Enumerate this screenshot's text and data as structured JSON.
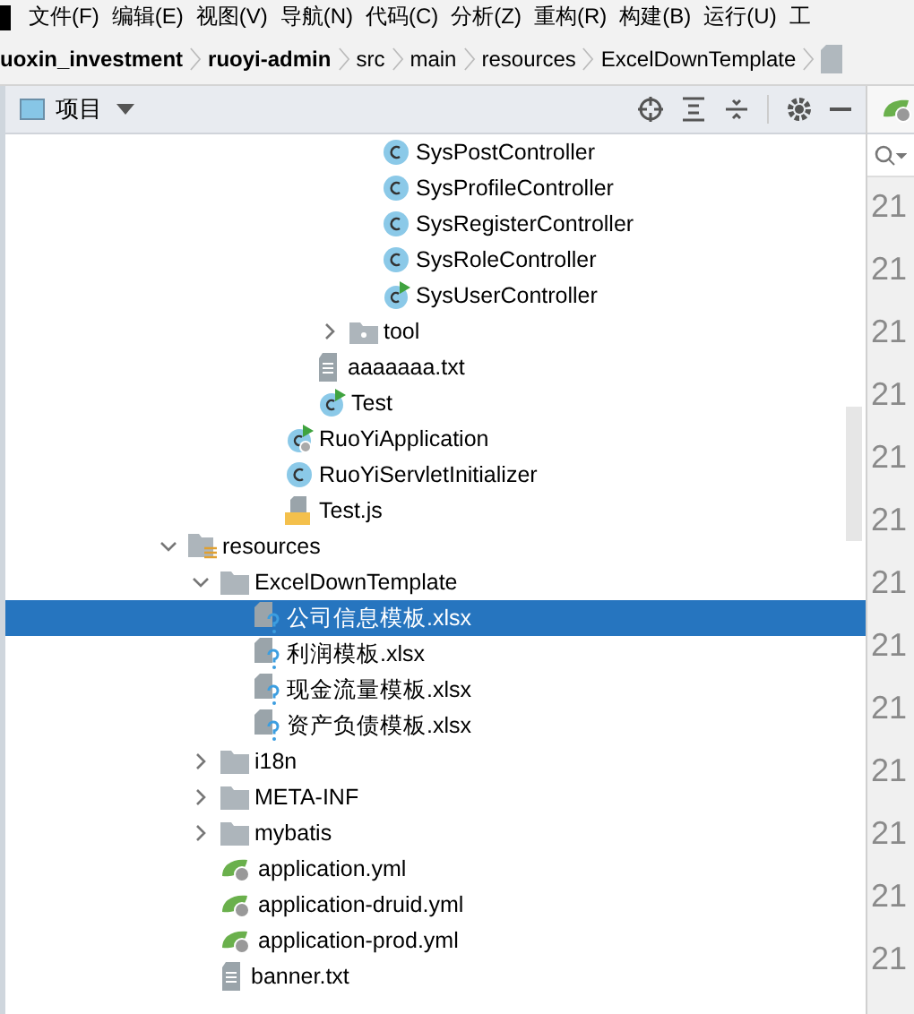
{
  "menu_bar": [
    "文件(F)",
    "编辑(E)",
    "视图(V)",
    "导航(N)",
    "代码(C)",
    "分析(Z)",
    "重构(R)",
    "构建(B)",
    "运行(U)",
    "工"
  ],
  "breadcrumb": [
    {
      "label": "uoxin_investment",
      "bold": true
    },
    {
      "label": "ruoyi-admin",
      "bold": true
    },
    {
      "label": "src",
      "bold": false
    },
    {
      "label": "main",
      "bold": false
    },
    {
      "label": "resources",
      "bold": false
    },
    {
      "label": "ExcelDownTemplate",
      "bold": false
    }
  ],
  "project_panel": {
    "title": "项目"
  },
  "tree": [
    {
      "kind": "group",
      "children": [
        {
          "kind": "group",
          "children": [
            {
              "kind": "group",
              "children": [
                {
                  "kind": "group",
                  "children": [
                    {
                      "kind": "group",
                      "children": [
                        {
                          "kind": "group",
                          "children": [
                            {
                              "kind": "class",
                              "label": "SysPostController",
                              "selected": false
                            },
                            {
                              "kind": "class",
                              "label": "SysProfileController",
                              "selected": false
                            },
                            {
                              "kind": "class",
                              "label": "SysRegisterController",
                              "selected": false
                            },
                            {
                              "kind": "class",
                              "label": "SysRoleController",
                              "selected": false
                            },
                            {
                              "kind": "runnable-class",
                              "label": "SysUserController",
                              "selected": false
                            }
                          ]
                        },
                        {
                          "kind": "package",
                          "label": "tool",
                          "expanded": false,
                          "selected": false
                        }
                      ]
                    },
                    {
                      "kind": "text-file",
                      "label": "aaaaaaa.txt",
                      "selected": false
                    },
                    {
                      "kind": "runnable-class",
                      "label": "Test",
                      "selected": false
                    }
                  ]
                },
                {
                  "kind": "app-class",
                  "label": "RuoYiApplication",
                  "selected": false
                },
                {
                  "kind": "class",
                  "label": "RuoYiServletInitializer",
                  "selected": false
                },
                {
                  "kind": "js-file",
                  "label": "Test.js",
                  "selected": false
                }
              ]
            }
          ]
        }
      ]
    },
    {
      "kind": "resources-folder",
      "label": "resources",
      "expanded": true,
      "selected": false,
      "children": [
        {
          "kind": "folder",
          "label": "ExcelDownTemplate",
          "expanded": true,
          "selected": false,
          "children": [
            {
              "kind": "unknown-file",
              "label": "公司信息模板.xlsx",
              "selected": true
            },
            {
              "kind": "unknown-file",
              "label": "利润模板.xlsx",
              "selected": false
            },
            {
              "kind": "unknown-file",
              "label": "现金流量模板.xlsx",
              "selected": false
            },
            {
              "kind": "unknown-file",
              "label": "资产负债模板.xlsx",
              "selected": false
            }
          ]
        },
        {
          "kind": "folder",
          "label": "i18n",
          "expanded": false,
          "selected": false
        },
        {
          "kind": "folder",
          "label": "META-INF",
          "expanded": false,
          "selected": false
        },
        {
          "kind": "folder",
          "label": "mybatis",
          "expanded": false,
          "selected": false
        },
        {
          "kind": "yml-file",
          "label": "application.yml",
          "selected": false
        },
        {
          "kind": "yml-file",
          "label": "application-druid.yml",
          "selected": false
        },
        {
          "kind": "yml-file",
          "label": "application-prod.yml",
          "selected": false
        },
        {
          "kind": "text-file",
          "label": "banner.txt",
          "selected": false
        }
      ]
    }
  ],
  "editor_gutter": [
    "21",
    "21",
    "21",
    "21",
    "21",
    "21",
    "21",
    "21",
    "21",
    "21",
    "21",
    "21",
    "21"
  ]
}
